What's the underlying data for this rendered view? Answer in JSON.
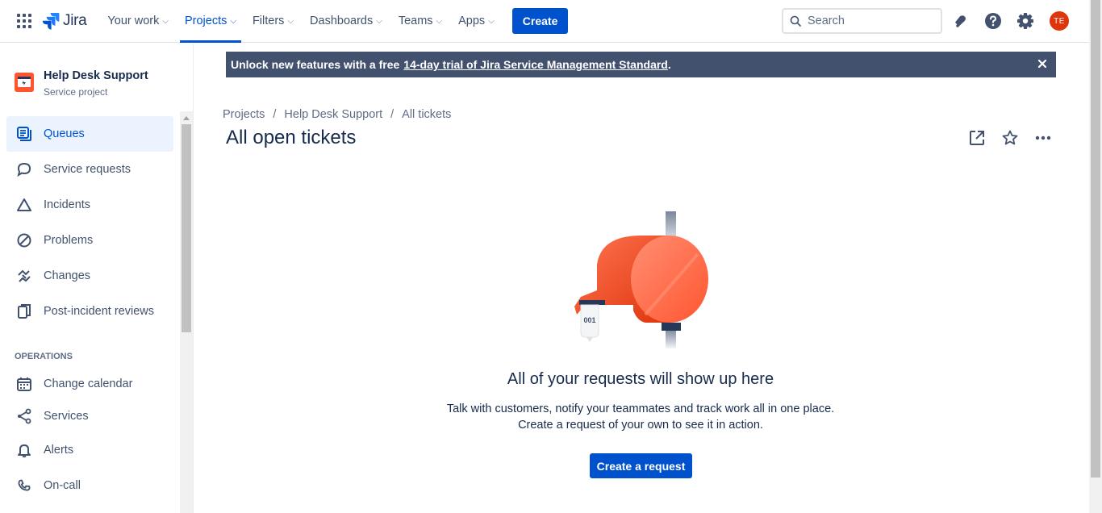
{
  "topnav": {
    "app_name": "Jira",
    "items": [
      {
        "label": "Your work",
        "active": false
      },
      {
        "label": "Projects",
        "active": true
      },
      {
        "label": "Filters",
        "active": false
      },
      {
        "label": "Dashboards",
        "active": false
      },
      {
        "label": "Teams",
        "active": false
      },
      {
        "label": "Apps",
        "active": false
      }
    ],
    "create_label": "Create",
    "search_placeholder": "Search",
    "avatar_initials": "TE",
    "icons": [
      "app-switcher-icon",
      "notifications-icon",
      "help-icon",
      "settings-icon"
    ]
  },
  "sidebar": {
    "project_name": "Help Desk Support",
    "project_type": "Service project",
    "items": [
      {
        "label": "Queues",
        "icon": "queues-icon",
        "active": true
      },
      {
        "label": "Service requests",
        "icon": "speech-bubble-icon",
        "active": false
      },
      {
        "label": "Incidents",
        "icon": "warning-triangle-icon",
        "active": false
      },
      {
        "label": "Problems",
        "icon": "prohibited-icon",
        "active": false
      },
      {
        "label": "Changes",
        "icon": "changes-icon",
        "active": false
      },
      {
        "label": "Post-incident reviews",
        "icon": "documents-icon",
        "active": false
      }
    ],
    "operations_heading": "OPERATIONS",
    "operations_items": [
      {
        "label": "Change calendar",
        "icon": "calendar-icon"
      },
      {
        "label": "Services",
        "icon": "services-icon"
      },
      {
        "label": "Alerts",
        "icon": "bell-icon"
      },
      {
        "label": "On-call",
        "icon": "phone-icon"
      }
    ]
  },
  "banner": {
    "text": "Unlock new features with a free",
    "link": "14-day trial of Jira Service Management Standard",
    "suffix": "."
  },
  "breadcrumb": [
    "Projects",
    "Help Desk Support",
    "All tickets"
  ],
  "page_title": "All open tickets",
  "empty_state": {
    "ticket_number": "001",
    "title": "All of your requests will show up here",
    "description_line1": "Talk with customers, notify your teammates and track work all in one place.",
    "description_line2": "Create a request of your own to see it in action.",
    "cta_label": "Create a request"
  },
  "colors": {
    "brand": "#0052cc",
    "banner_bg": "#42526e",
    "active_item_bg": "#ebf3ff",
    "avatar_bg": "#de350b",
    "illustration_primary": "#ff5630"
  }
}
